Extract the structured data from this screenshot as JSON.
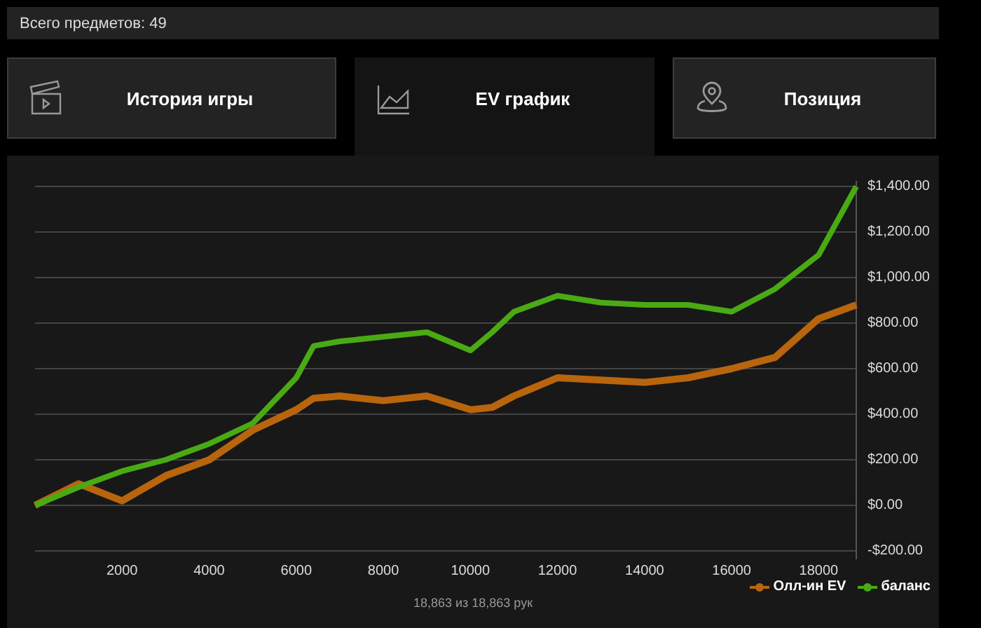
{
  "summary": "Всего предметов: 49",
  "tabs": [
    {
      "label": "История игры",
      "selected": false
    },
    {
      "label": "EV график",
      "selected": true
    },
    {
      "label": "Позиция",
      "selected": false
    }
  ],
  "chart_data": {
    "type": "line",
    "x": [
      0,
      1000,
      2000,
      3000,
      4000,
      5000,
      6000,
      6400,
      7000,
      8000,
      9000,
      10000,
      10500,
      11000,
      12000,
      13000,
      14000,
      15000,
      16000,
      17000,
      18000,
      18863
    ],
    "series": [
      {
        "name": "Олл-ин EV",
        "color": "#b8650e",
        "values": [
          0,
          95,
          20,
          130,
          200,
          330,
          420,
          470,
          480,
          460,
          480,
          420,
          430,
          480,
          560,
          550,
          540,
          560,
          600,
          650,
          820,
          880
        ]
      },
      {
        "name": "баланс",
        "color": "#4aaa14",
        "values": [
          0,
          80,
          150,
          200,
          270,
          360,
          560,
          700,
          720,
          740,
          760,
          680,
          760,
          850,
          920,
          890,
          880,
          880,
          850,
          950,
          1100,
          1400
        ]
      }
    ],
    "grid": true,
    "xlim": [
      0,
      18863
    ],
    "ylim": [
      -200,
      1400
    ],
    "xticks": [
      2000,
      4000,
      6000,
      8000,
      10000,
      12000,
      14000,
      16000,
      18000
    ],
    "yticks": [
      {
        "value": 1400,
        "label": "$1,400.00"
      },
      {
        "value": 1200,
        "label": "$1,200.00"
      },
      {
        "value": 1000,
        "label": "$1,000.00"
      },
      {
        "value": 800,
        "label": "$800.00"
      },
      {
        "value": 600,
        "label": "$600.00"
      },
      {
        "value": 400,
        "label": "$400.00"
      },
      {
        "value": 200,
        "label": "$200.00"
      },
      {
        "value": 0,
        "label": "$0.00"
      },
      {
        "value": -200,
        "label": "-$200.00"
      }
    ]
  },
  "hands_caption": "18,863 из 18,863 рук"
}
